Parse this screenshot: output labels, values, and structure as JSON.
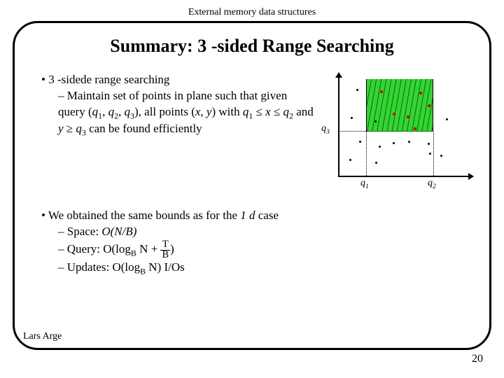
{
  "header": "External memory data structures",
  "title": "Summary: 3 -sided Range Searching",
  "bullet1": {
    "head": "3 -sidede range searching",
    "sub1a": "Maintain set of points in plane such that given query (",
    "q1": "q",
    "s1": "1",
    "c1": ", ",
    "q2": "q",
    "s2": "2",
    "c2": ", ",
    "q3": "q",
    "s3": "3",
    "c3": "), all points (",
    "xy": "x, y",
    "mid": ") with ",
    "qa": "q",
    "sa": "1",
    "le1": " ≤ ",
    "x": "x",
    "le2": " ≤ ",
    "qb": "q",
    "sb": "2",
    "and": " and ",
    "y": "y",
    "ge": " ≥ ",
    "qc": "q",
    "sc": "3",
    "tail": " can be found efficiently"
  },
  "bullet2": {
    "head": "We obtained the same bounds as for the ",
    "oned": "1 d",
    "headtail": " case",
    "space_lbl": "Space: ",
    "space_val": "O(N/B)",
    "query_lbl": "Query: ",
    "query_val": "O(log_B N + T/B)",
    "updates_lbl": "Updates: ",
    "updates_val": "O(log_B N)",
    "updates_tail": " I/Os"
  },
  "diagram": {
    "q1": "q",
    "q1s": "1",
    "q2": "q",
    "q2s": "2",
    "q3": "q",
    "q3s": "3"
  },
  "footer": {
    "author": "Lars Arge",
    "page": "20"
  }
}
